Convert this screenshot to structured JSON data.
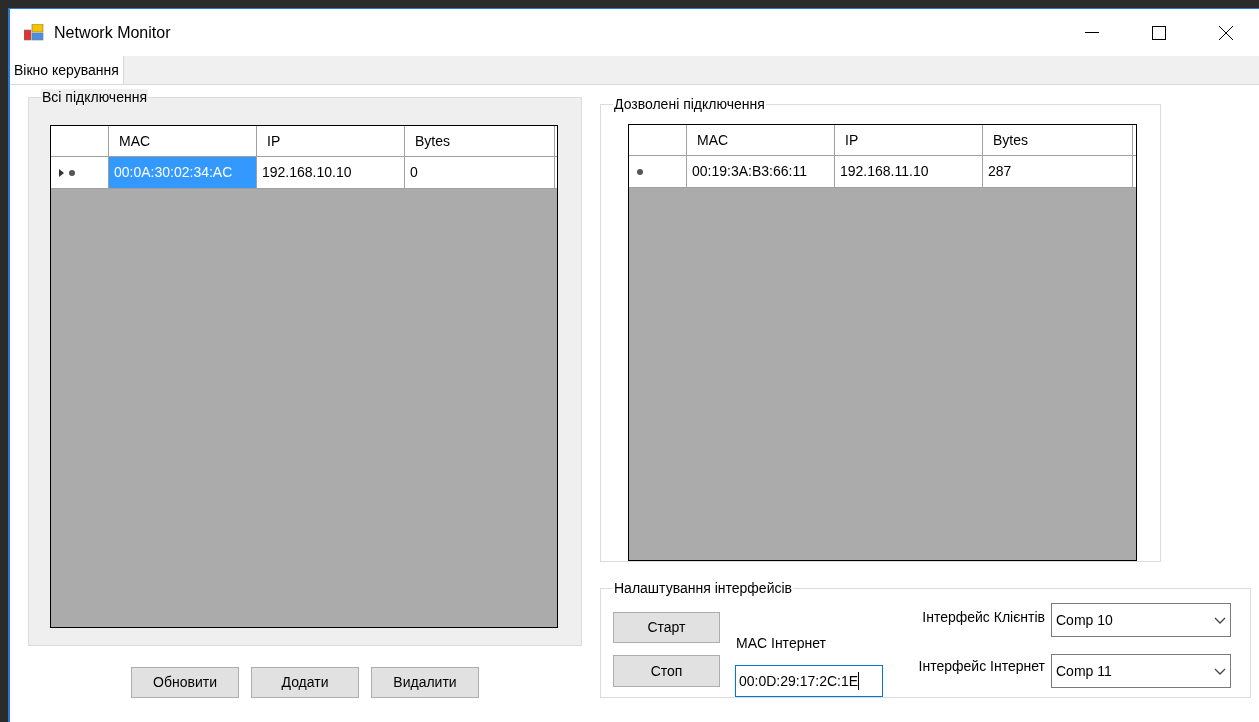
{
  "window": {
    "title": "Network Monitor"
  },
  "tabs": [
    {
      "label": "Вікно керування",
      "selected": true
    }
  ],
  "all_connections": {
    "title": "Всі підключення",
    "columns": [
      "MAC",
      "IP",
      "Bytes"
    ],
    "rows": [
      {
        "current": true,
        "cells": [
          {
            "text": "00:0A:30:02:34:AC",
            "selected": true
          },
          {
            "text": "192.168.10.10",
            "selected": false
          },
          {
            "text": "0",
            "selected": false
          }
        ]
      }
    ]
  },
  "action_buttons": [
    "Обновити",
    "Додати",
    "Видалити"
  ],
  "allowed_connections": {
    "title": "Дозволені підключення",
    "columns": [
      "MAC",
      "IP",
      "Bytes"
    ],
    "rows": [
      {
        "current": false,
        "cells": [
          {
            "text": "00:19:3A:B3:66:11",
            "selected": false
          },
          {
            "text": "192.168.11.10",
            "selected": false
          },
          {
            "text": "287",
            "selected": false
          }
        ]
      }
    ]
  },
  "interface_settings": {
    "title": "Налаштування інтерфейсів",
    "start_button": "Старт",
    "stop_button": "Стоп",
    "mac_label": "MAC Інтернет",
    "mac_value": "00:0D:29:17:2C:1E",
    "clients_label": "Інтерфейс Клієнтів",
    "clients_value": "Comp 10",
    "internet_label": "Інтерфейс Інтернет",
    "internet_value": "Comp 11"
  }
}
